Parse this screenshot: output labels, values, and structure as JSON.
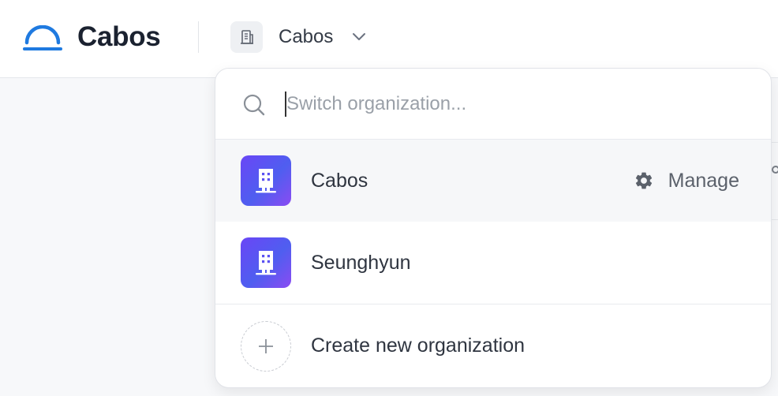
{
  "header": {
    "brand": "Cabos",
    "org_switcher": {
      "current": "Cabos"
    }
  },
  "dropdown": {
    "search": {
      "placeholder": "Switch organization...",
      "value": ""
    },
    "organizations": [
      {
        "name": "Cabos",
        "selected": true,
        "action_label": "Manage"
      },
      {
        "name": "Seunghyun",
        "selected": false
      }
    ],
    "create_label": "Create new organization"
  },
  "colors": {
    "brand_blue": "#1f7ae0",
    "avatar_gradient_start": "#6a46f6",
    "avatar_gradient_end": "#8a4bf2"
  },
  "icons": [
    "logo-arch-icon",
    "building-icon",
    "chevron-down-icon",
    "search-icon",
    "gear-icon",
    "plus-icon"
  ]
}
